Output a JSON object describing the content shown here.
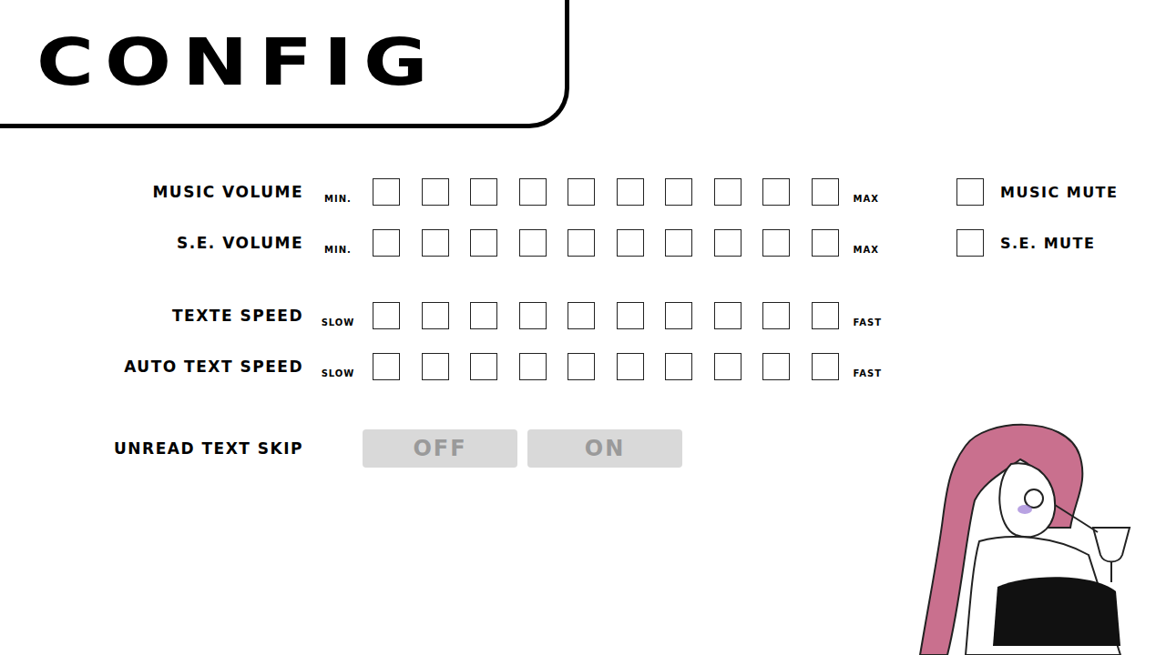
{
  "title": "CONFIG",
  "volume_sliders": [
    {
      "label": "MUSIC VOLUME",
      "kind": "slider",
      "min_label": "MIN.",
      "max_label": "MAX",
      "level": 0,
      "mute": {
        "label": "MUSIC MUTE",
        "checked": false
      }
    },
    {
      "label": "S.E. VOLUME",
      "kind": "slider",
      "min_label": "MIN.",
      "max_label": "MAX",
      "level": 0,
      "mute": {
        "label": "S.E. MUTE",
        "checked": false
      }
    }
  ],
  "text_speed_sliders": [
    {
      "label": "TEXTE SPEED",
      "kind": "slider",
      "min_label": "SLOW",
      "max_label": "FAST",
      "level": 0
    },
    {
      "label": "AUTO TEXT SPEED",
      "kind": "slider",
      "min_label": "SLOW",
      "max_label": "FAST",
      "level": 0
    }
  ],
  "unread_text_skip": {
    "label": "UNREAD TEXT SKIP",
    "options": [
      {
        "label": "OFF",
        "selected": false
      },
      {
        "label": "ON",
        "selected": false
      }
    ]
  }
}
